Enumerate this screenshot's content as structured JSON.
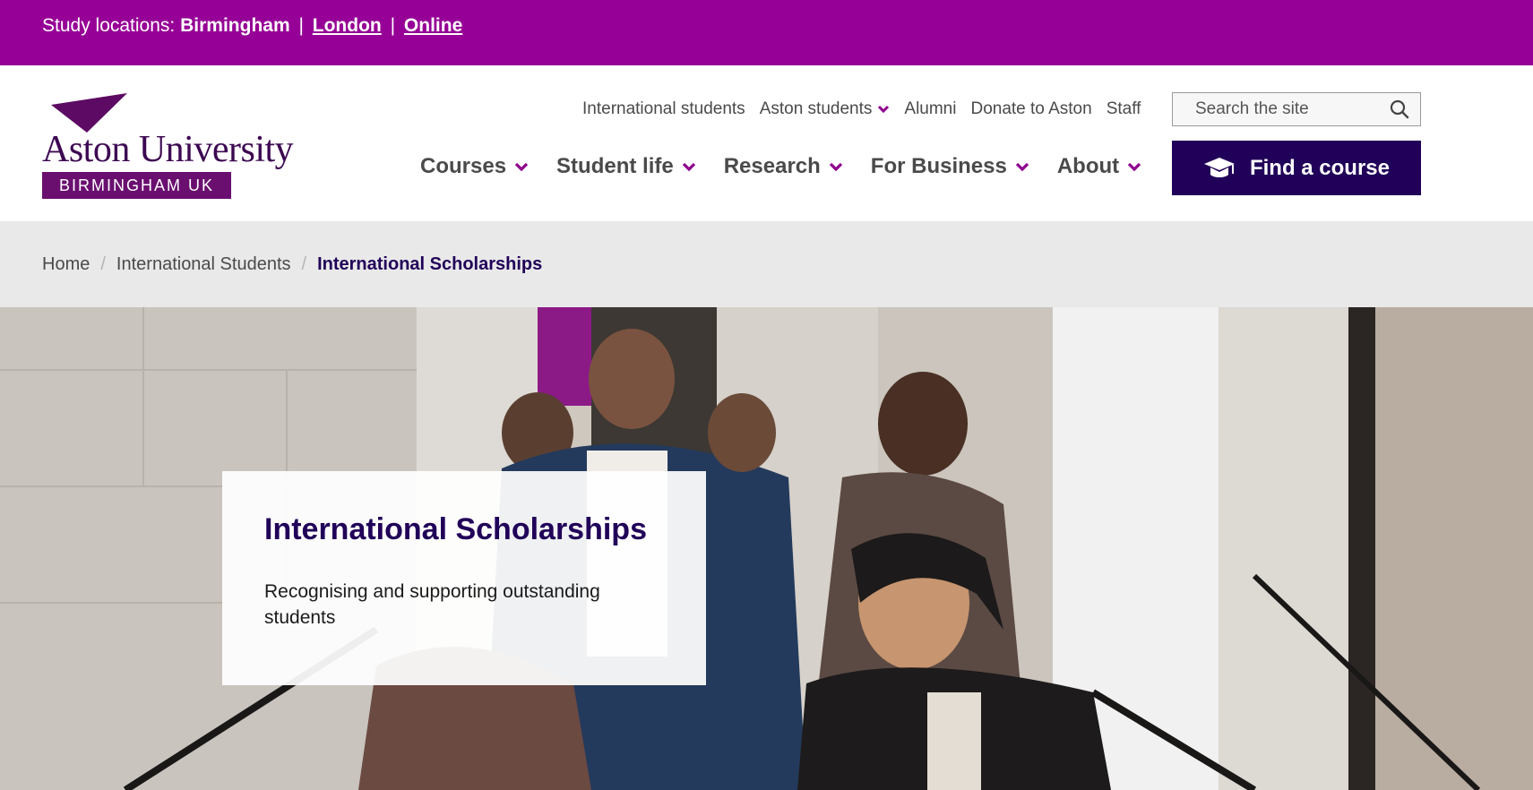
{
  "topbar": {
    "prefix": "Study locations:",
    "current": "Birmingham",
    "links": [
      "London",
      "Online"
    ],
    "separator": "|"
  },
  "logo": {
    "wordmark": "Aston University",
    "subtitle": "BIRMINGHAM UK"
  },
  "utility_nav": [
    "International students",
    "Aston students",
    "Alumni",
    "Donate to Aston",
    "Staff"
  ],
  "search": {
    "placeholder": "Search the site",
    "icon": "search-icon"
  },
  "main_nav": [
    "Courses",
    "Student life",
    "Research",
    "For Business",
    "About"
  ],
  "find_course": {
    "label": "Find a course",
    "icon": "graduation-cap-icon"
  },
  "breadcrumb": {
    "items": [
      "Home",
      "International Students"
    ],
    "current": "International Scholarships",
    "separator": "/"
  },
  "hero": {
    "title": "International Scholarships",
    "text": "Recognising and supporting outstanding students"
  },
  "colors": {
    "topbar": "#960096",
    "brand_dark": "#200058",
    "accent_chevron": "#8e008e",
    "breadcrumb_bg": "#e9e9e9"
  }
}
